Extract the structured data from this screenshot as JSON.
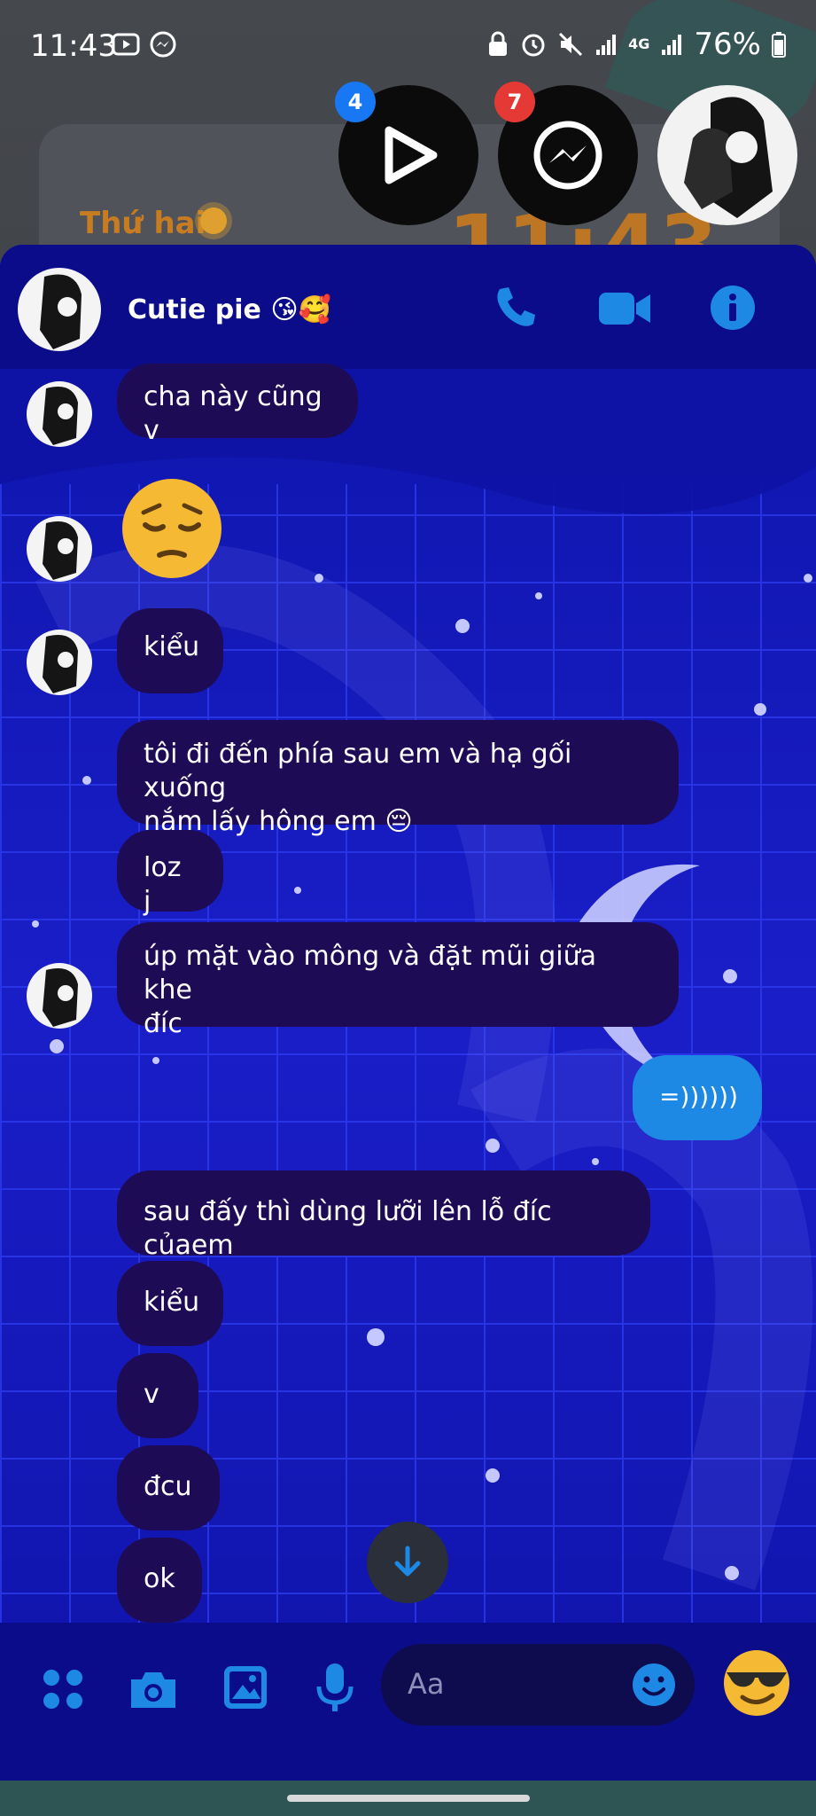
{
  "status_bar": {
    "time": "11:43",
    "battery": "76%",
    "network": "4G",
    "notif_icons": [
      "youtube-icon",
      "messenger-icon"
    ],
    "system_icons": [
      "lock-icon",
      "alarm-icon",
      "mute-icon",
      "signal-icon",
      "battery-icon"
    ]
  },
  "home_widget": {
    "day": "Thứ hai",
    "clock": "11:43"
  },
  "chat_heads": [
    {
      "app": "youtube",
      "badge": "4",
      "badge_color": "#1877f2"
    },
    {
      "app": "messenger",
      "badge": "7",
      "badge_color": "#e53935"
    },
    {
      "app": "contact-avatar",
      "badge": ""
    }
  ],
  "conversation": {
    "contact_name": "Cutie pie 😘🥰",
    "accent": "#1e88e5",
    "panel_color": "#1418b8",
    "incoming_bubble_color": "#1e0b55"
  },
  "messages": [
    {
      "id": "m1",
      "direction": "in",
      "text": "cha này cũng v",
      "avatar": true
    },
    {
      "id": "m2",
      "direction": "in",
      "type": "emoji",
      "text": "😔",
      "avatar": true
    },
    {
      "id": "m3",
      "direction": "in",
      "text": "kiểu",
      "avatar": true
    },
    {
      "id": "m4",
      "direction": "in",
      "line1": "tôi đi đến phía sau em và hạ gối xuống",
      "line2": "nắm lấy hông em 😔",
      "avatar": false
    },
    {
      "id": "m5",
      "direction": "in",
      "text": "loz j",
      "avatar": false
    },
    {
      "id": "m6",
      "direction": "in",
      "line1": "úp mặt vào mông và đặt mũi giữa khe",
      "line2": "đíc",
      "avatar": true
    },
    {
      "id": "m7",
      "direction": "out",
      "text": "=))))))"
    },
    {
      "id": "m8",
      "direction": "in",
      "text": "sau đấy thì dùng lưỡi lên lỗ đíc củaem",
      "avatar": false
    },
    {
      "id": "m9",
      "direction": "in",
      "text": "kiểu",
      "avatar": false
    },
    {
      "id": "m10",
      "direction": "in",
      "text": " v",
      "avatar": false
    },
    {
      "id": "m11",
      "direction": "in",
      "text": "đcu",
      "avatar": false
    },
    {
      "id": "m12",
      "direction": "in",
      "text": "ok",
      "avatar": false
    }
  ],
  "composer": {
    "placeholder": "Aa",
    "buttons": [
      "more-icon",
      "camera-icon",
      "gallery-icon",
      "microphone-icon",
      "emoji-icon",
      "quick-reaction-emoji"
    ],
    "quick_reaction": "😎"
  }
}
